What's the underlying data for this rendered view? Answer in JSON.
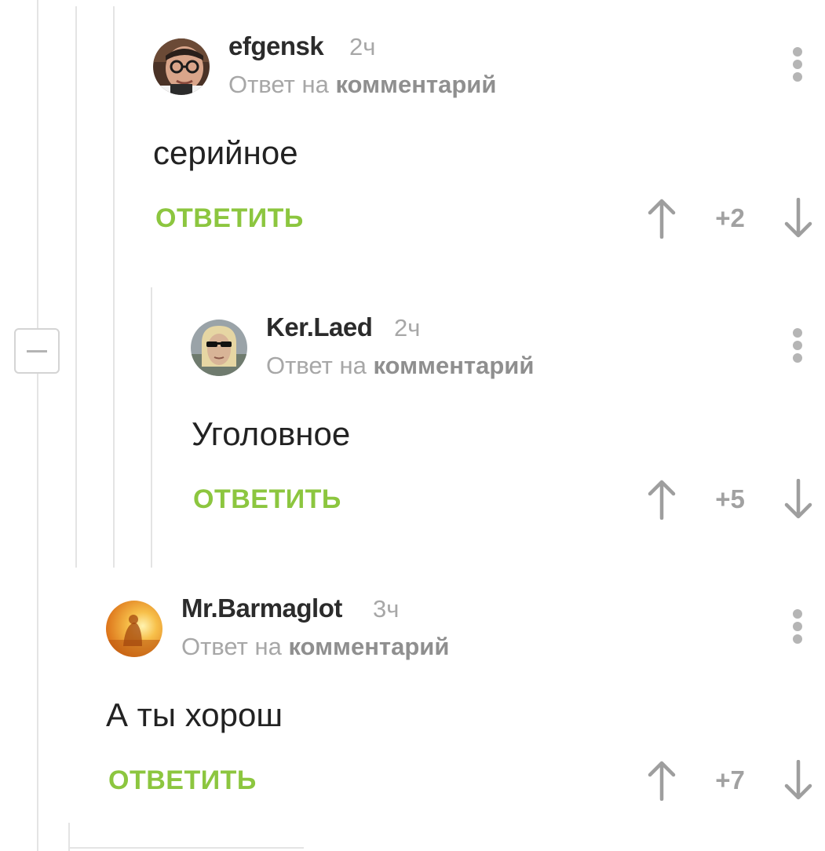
{
  "comments": [
    {
      "username": "efgensk",
      "time": "2ч",
      "reply_prefix": "Ответ на",
      "reply_target": "комментарий",
      "text": "серийное",
      "reply_label": "ОТВЕТИТЬ",
      "rating": "+2",
      "avatar_icon": "avatar-man-glasses"
    },
    {
      "username": "Ker.Laed",
      "time": "2ч",
      "reply_prefix": "Ответ на",
      "reply_target": "комментарий",
      "text": "Уголовное",
      "reply_label": "ОТВЕТИТЬ",
      "rating": "+5",
      "avatar_icon": "avatar-man-sunglasses"
    },
    {
      "username": "Mr.Barmaglot",
      "time": "3ч",
      "reply_prefix": "Ответ на",
      "reply_target": "комментарий",
      "text": "А ты хорош",
      "reply_label": "ОТВЕТИТЬ",
      "rating": "+7",
      "avatar_icon": "avatar-sunset-meditation"
    }
  ],
  "colors": {
    "accent_green": "#8cc63f",
    "muted_gray": "#a7a7a7",
    "thread_line": "#e4e4e4"
  },
  "icons": {
    "upvote": "arrow-up-icon",
    "downvote": "arrow-down-icon",
    "more": "kebab-menu-icon",
    "collapse": "minus-icon"
  }
}
